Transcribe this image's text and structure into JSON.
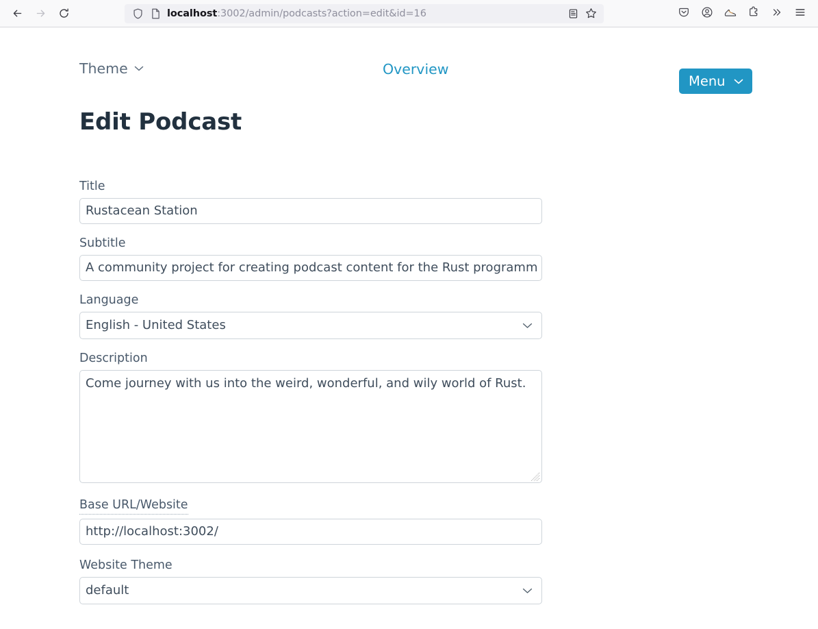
{
  "browser": {
    "back_icon": "back-arrow-icon",
    "forward_icon": "forward-arrow-icon",
    "reload_icon": "reload-icon",
    "shield_icon": "shield-icon",
    "page_icon": "page-document-icon",
    "url_host": "localhost",
    "url_rest": ":3002/admin/podcasts?action=edit&id=16",
    "url_full": "localhost:3002/admin/podcasts?action=edit&id=16",
    "reader_icon": "reader-view-icon",
    "bookmark_icon": "star-bookmark-icon",
    "right_icons": [
      "pocket-save-icon",
      "account-circle-icon",
      "sneaker-extension-icon",
      "extensions-puzzle-icon",
      "overflow-chevrons-icon",
      "hamburger-menu-icon"
    ]
  },
  "navbar": {
    "theme_label": "Theme",
    "theme_caret": "chevron-down-icon",
    "overview_label": "Overview",
    "menu_label": "Menu",
    "menu_caret": "chevron-down-icon",
    "accent_color": "#2196c4",
    "theme_color": "#5b6b7c"
  },
  "page": {
    "title": "Edit Podcast"
  },
  "form": {
    "fields": [
      {
        "label": "Title",
        "type": "text",
        "value": "Rustacean Station"
      },
      {
        "label": "Subtitle",
        "type": "text",
        "value": "A community project for creating podcast content for the Rust programm"
      },
      {
        "label": "Language",
        "type": "select",
        "value": "English - United States"
      },
      {
        "label": "Description",
        "type": "textarea",
        "value": "Come journey with us into the weird, wonderful, and wily world of Rust."
      },
      {
        "label": "Base URL/Website",
        "type": "text",
        "value": "http://localhost:3002/"
      },
      {
        "label": "Website Theme",
        "type": "select",
        "value": "default"
      }
    ]
  }
}
